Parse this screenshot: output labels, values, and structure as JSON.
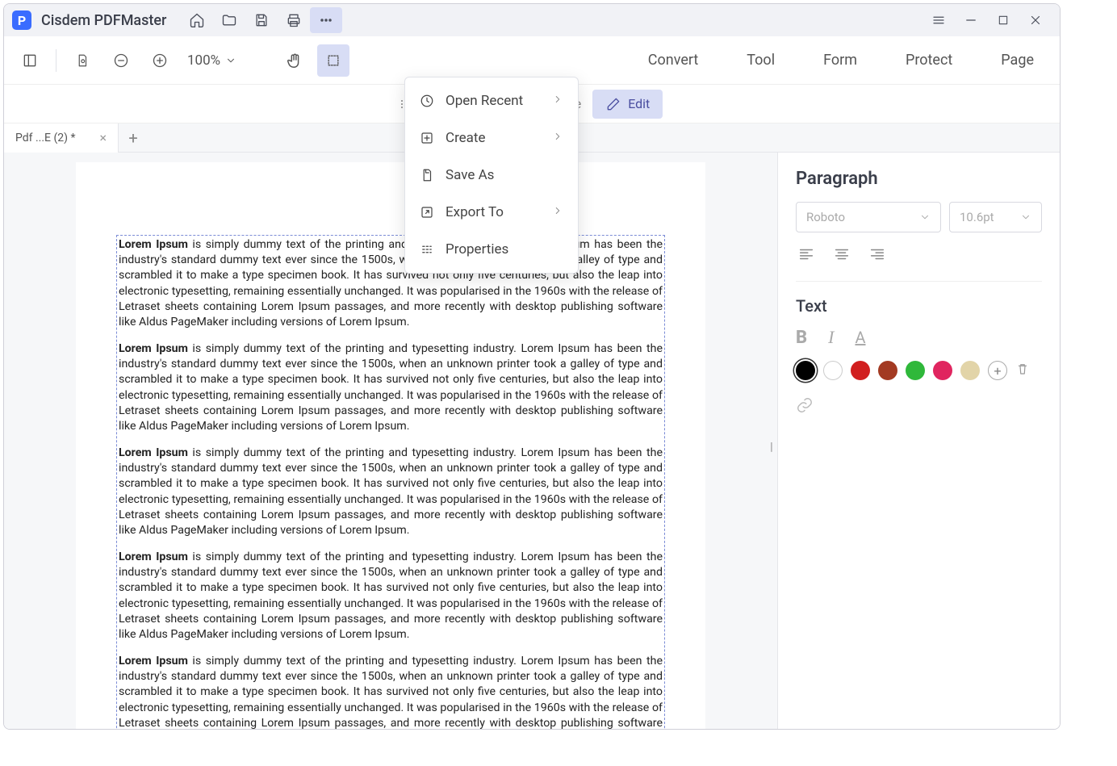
{
  "app_title": "Cisdem PDFMaster",
  "zoom": "100%",
  "nav": {
    "convert": "Convert",
    "tool": "Tool",
    "form": "Form",
    "protect": "Protect",
    "page": "Page"
  },
  "secondary": {
    "page_faded": "ge",
    "edit": "Edit"
  },
  "tab": {
    "name": "Pdf ...E (2) *"
  },
  "menu": {
    "open_recent": "Open Recent",
    "create": "Create",
    "save_as": "Save As",
    "export_to": "Export To",
    "properties": "Properties"
  },
  "document": {
    "lead": "Lorem Ipsum",
    "body": " is simply dummy text of the printing and typesetting industry. Lorem Ipsum has been the industry's standard dummy text ever since the 1500s, when an unknown printer took a galley of type and scrambled it to make a type specimen book. It has survived not only five centuries, but also the leap into electronic typesetting, remaining essentially unchanged. It was popularised in the 1960s with the release of Letraset sheets containing Lorem Ipsum passages, and more recently with desktop publishing software like Aldus PageMaker including versions of Lorem Ipsum."
  },
  "panel": {
    "paragraph": "Paragraph",
    "font": "Roboto",
    "size": "10.6pt",
    "text": "Text",
    "colors": [
      "#000000",
      "#ffffff",
      "#d11f1f",
      "#a33a22",
      "#2fb83a",
      "#e0255f",
      "#e2d4a8"
    ]
  }
}
